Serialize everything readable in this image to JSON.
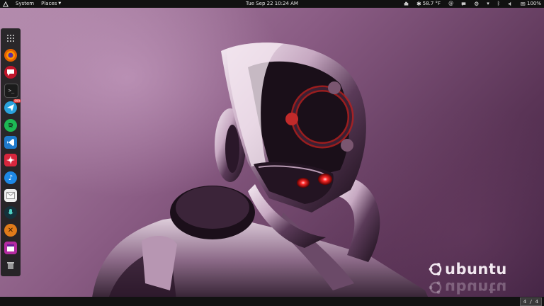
{
  "top_panel": {
    "menus": [
      {
        "label": "System"
      },
      {
        "label": "Places"
      }
    ],
    "clock": "Tue Sep 22 10:24 AM",
    "weather": "58.7 °F",
    "battery": "100%"
  },
  "dock": {
    "items": [
      {
        "name": "app-grid",
        "color": "#2b2b2b"
      },
      {
        "name": "firefox",
        "color": "#e66000"
      },
      {
        "name": "chat",
        "color": "#c0152a"
      },
      {
        "name": "terminal",
        "color": "#1b1b1b"
      },
      {
        "name": "telegram",
        "color": "#2aa2dd",
        "badge": "999"
      },
      {
        "name": "spotify",
        "color": "#1db954"
      },
      {
        "name": "vscode",
        "color": "#1f7acb"
      },
      {
        "name": "app-red",
        "color": "#d7263d"
      },
      {
        "name": "deezer",
        "color": "#1e88e5"
      },
      {
        "name": "files",
        "color": "#eeeeee"
      },
      {
        "name": "recorder",
        "color": "#15313a"
      },
      {
        "name": "x-app",
        "color": "#e07b1a"
      },
      {
        "name": "window-app",
        "color": "#b52ba1"
      },
      {
        "name": "trash",
        "color": "#444444"
      }
    ]
  },
  "wallpaper": {
    "logo_text": "ubuntu"
  },
  "bottom_panel": {
    "workspace": "4 / 4"
  }
}
